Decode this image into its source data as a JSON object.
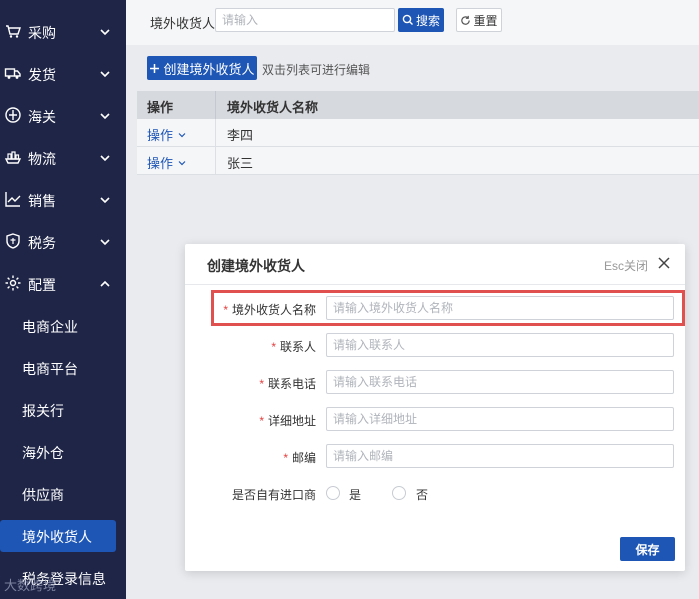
{
  "sidebar": {
    "items": [
      {
        "label": "采购",
        "icon": "cart-icon"
      },
      {
        "label": "发货",
        "icon": "truck-icon"
      },
      {
        "label": "海关",
        "icon": "anchor-icon"
      },
      {
        "label": "物流",
        "icon": "ship-icon"
      },
      {
        "label": "销售",
        "icon": "chart-line-icon"
      },
      {
        "label": "税务",
        "icon": "shield-icon"
      },
      {
        "label": "配置",
        "icon": "gear-icon"
      }
    ],
    "sub_items": [
      "电商企业",
      "电商平台",
      "报关行",
      "海外仓",
      "供应商",
      "境外收货人",
      "税务登录信息"
    ],
    "active_sub": "境外收货人",
    "watermark": "大数跨境"
  },
  "search": {
    "label": "境外收货人",
    "placeholder": "请输入",
    "search_label": "搜索",
    "reset_label": "重置"
  },
  "toolbar": {
    "create_label": "创建境外收货人",
    "hint": "双击列表可进行编辑"
  },
  "table": {
    "headers": [
      "操作",
      "境外收货人名称"
    ],
    "rows": [
      {
        "op": "操作",
        "name": "李四"
      },
      {
        "op": "操作",
        "name": "张三"
      }
    ]
  },
  "modal": {
    "title": "创建境外收货人",
    "esc_label": "Esc关闭",
    "fields": [
      {
        "label": "境外收货人名称",
        "placeholder": "请输入境外收货人名称",
        "required": true
      },
      {
        "label": "联系人",
        "placeholder": "请输入联系人",
        "required": true
      },
      {
        "label": "联系电话",
        "placeholder": "请输入联系电话",
        "required": true
      },
      {
        "label": "详细地址",
        "placeholder": "请输入详细地址",
        "required": true
      },
      {
        "label": "邮编",
        "placeholder": "请输入邮编",
        "required": true
      }
    ],
    "import_label": "是否自有进口商",
    "yes_label": "是",
    "no_label": "否",
    "save_label": "保存"
  },
  "colors": {
    "sidebar_bg": "#1f2547",
    "primary": "#1e56b6",
    "highlight": "#e0504f",
    "required": "#e34040"
  }
}
